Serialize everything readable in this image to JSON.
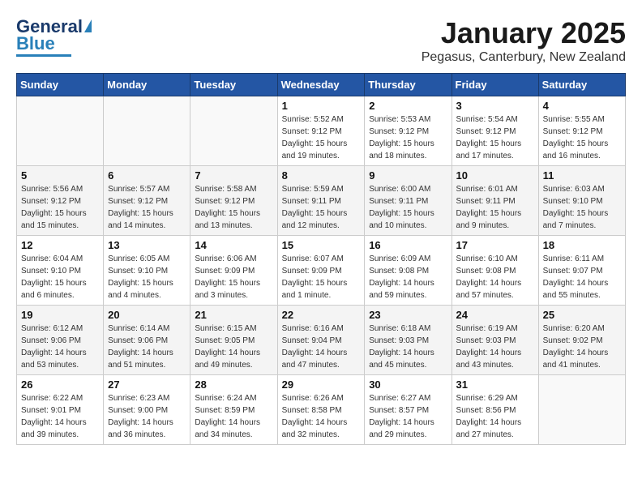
{
  "header": {
    "logo_general": "General",
    "logo_blue": "Blue",
    "month_title": "January 2025",
    "subtitle": "Pegasus, Canterbury, New Zealand"
  },
  "weekdays": [
    "Sunday",
    "Monday",
    "Tuesday",
    "Wednesday",
    "Thursday",
    "Friday",
    "Saturday"
  ],
  "weeks": [
    [
      {
        "day": "",
        "detail": ""
      },
      {
        "day": "",
        "detail": ""
      },
      {
        "day": "",
        "detail": ""
      },
      {
        "day": "1",
        "detail": "Sunrise: 5:52 AM\nSunset: 9:12 PM\nDaylight: 15 hours\nand 19 minutes."
      },
      {
        "day": "2",
        "detail": "Sunrise: 5:53 AM\nSunset: 9:12 PM\nDaylight: 15 hours\nand 18 minutes."
      },
      {
        "day": "3",
        "detail": "Sunrise: 5:54 AM\nSunset: 9:12 PM\nDaylight: 15 hours\nand 17 minutes."
      },
      {
        "day": "4",
        "detail": "Sunrise: 5:55 AM\nSunset: 9:12 PM\nDaylight: 15 hours\nand 16 minutes."
      }
    ],
    [
      {
        "day": "5",
        "detail": "Sunrise: 5:56 AM\nSunset: 9:12 PM\nDaylight: 15 hours\nand 15 minutes."
      },
      {
        "day": "6",
        "detail": "Sunrise: 5:57 AM\nSunset: 9:12 PM\nDaylight: 15 hours\nand 14 minutes."
      },
      {
        "day": "7",
        "detail": "Sunrise: 5:58 AM\nSunset: 9:12 PM\nDaylight: 15 hours\nand 13 minutes."
      },
      {
        "day": "8",
        "detail": "Sunrise: 5:59 AM\nSunset: 9:11 PM\nDaylight: 15 hours\nand 12 minutes."
      },
      {
        "day": "9",
        "detail": "Sunrise: 6:00 AM\nSunset: 9:11 PM\nDaylight: 15 hours\nand 10 minutes."
      },
      {
        "day": "10",
        "detail": "Sunrise: 6:01 AM\nSunset: 9:11 PM\nDaylight: 15 hours\nand 9 minutes."
      },
      {
        "day": "11",
        "detail": "Sunrise: 6:03 AM\nSunset: 9:10 PM\nDaylight: 15 hours\nand 7 minutes."
      }
    ],
    [
      {
        "day": "12",
        "detail": "Sunrise: 6:04 AM\nSunset: 9:10 PM\nDaylight: 15 hours\nand 6 minutes."
      },
      {
        "day": "13",
        "detail": "Sunrise: 6:05 AM\nSunset: 9:10 PM\nDaylight: 15 hours\nand 4 minutes."
      },
      {
        "day": "14",
        "detail": "Sunrise: 6:06 AM\nSunset: 9:09 PM\nDaylight: 15 hours\nand 3 minutes."
      },
      {
        "day": "15",
        "detail": "Sunrise: 6:07 AM\nSunset: 9:09 PM\nDaylight: 15 hours\nand 1 minute."
      },
      {
        "day": "16",
        "detail": "Sunrise: 6:09 AM\nSunset: 9:08 PM\nDaylight: 14 hours\nand 59 minutes."
      },
      {
        "day": "17",
        "detail": "Sunrise: 6:10 AM\nSunset: 9:08 PM\nDaylight: 14 hours\nand 57 minutes."
      },
      {
        "day": "18",
        "detail": "Sunrise: 6:11 AM\nSunset: 9:07 PM\nDaylight: 14 hours\nand 55 minutes."
      }
    ],
    [
      {
        "day": "19",
        "detail": "Sunrise: 6:12 AM\nSunset: 9:06 PM\nDaylight: 14 hours\nand 53 minutes."
      },
      {
        "day": "20",
        "detail": "Sunrise: 6:14 AM\nSunset: 9:06 PM\nDaylight: 14 hours\nand 51 minutes."
      },
      {
        "day": "21",
        "detail": "Sunrise: 6:15 AM\nSunset: 9:05 PM\nDaylight: 14 hours\nand 49 minutes."
      },
      {
        "day": "22",
        "detail": "Sunrise: 6:16 AM\nSunset: 9:04 PM\nDaylight: 14 hours\nand 47 minutes."
      },
      {
        "day": "23",
        "detail": "Sunrise: 6:18 AM\nSunset: 9:03 PM\nDaylight: 14 hours\nand 45 minutes."
      },
      {
        "day": "24",
        "detail": "Sunrise: 6:19 AM\nSunset: 9:03 PM\nDaylight: 14 hours\nand 43 minutes."
      },
      {
        "day": "25",
        "detail": "Sunrise: 6:20 AM\nSunset: 9:02 PM\nDaylight: 14 hours\nand 41 minutes."
      }
    ],
    [
      {
        "day": "26",
        "detail": "Sunrise: 6:22 AM\nSunset: 9:01 PM\nDaylight: 14 hours\nand 39 minutes."
      },
      {
        "day": "27",
        "detail": "Sunrise: 6:23 AM\nSunset: 9:00 PM\nDaylight: 14 hours\nand 36 minutes."
      },
      {
        "day": "28",
        "detail": "Sunrise: 6:24 AM\nSunset: 8:59 PM\nDaylight: 14 hours\nand 34 minutes."
      },
      {
        "day": "29",
        "detail": "Sunrise: 6:26 AM\nSunset: 8:58 PM\nDaylight: 14 hours\nand 32 minutes."
      },
      {
        "day": "30",
        "detail": "Sunrise: 6:27 AM\nSunset: 8:57 PM\nDaylight: 14 hours\nand 29 minutes."
      },
      {
        "day": "31",
        "detail": "Sunrise: 6:29 AM\nSunset: 8:56 PM\nDaylight: 14 hours\nand 27 minutes."
      },
      {
        "day": "",
        "detail": ""
      }
    ]
  ]
}
